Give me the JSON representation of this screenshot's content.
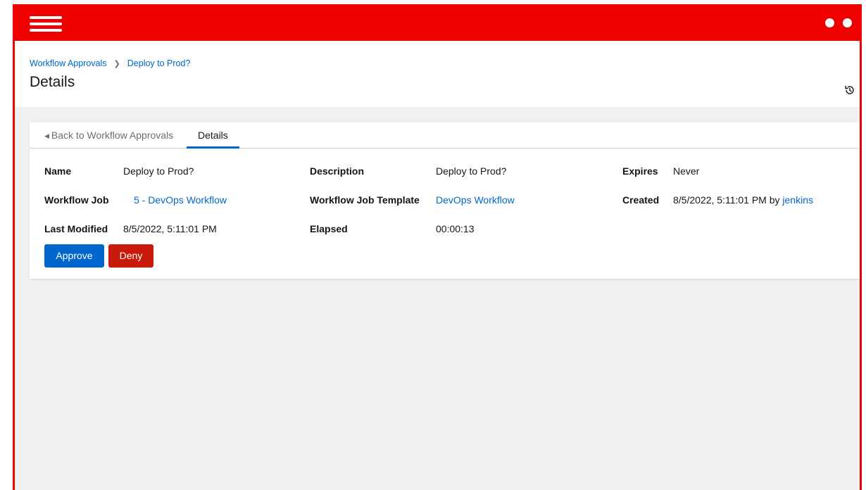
{
  "colors": {
    "brand": "#ee0000",
    "link": "#0066cc",
    "danger": "#c9190b",
    "background": "#f0f0f0"
  },
  "topbar": {
    "menu_icon": "hamburger-icon",
    "window_icon": "dots-icon"
  },
  "breadcrumb": {
    "parent": "Workflow Approvals",
    "current": "Deploy to Prod?"
  },
  "header": {
    "title": "Details",
    "history_icon": "history-icon"
  },
  "tabs": {
    "back_label": "Back to Workflow Approvals",
    "active_label": "Details"
  },
  "details": {
    "name_label": "Name",
    "name_value": "Deploy to Prod?",
    "description_label": "Description",
    "description_value": "Deploy to Prod?",
    "expires_label": "Expires",
    "expires_value": "Never",
    "workflow_job_label": "Workflow Job",
    "workflow_job_value": "5 - DevOps Workflow",
    "workflow_job_template_label": "Workflow Job Template",
    "workflow_job_template_value": "DevOps Workflow",
    "created_label": "Created",
    "created_value": "8/5/2022, 5:11:01 PM by",
    "created_by": "jenkins",
    "last_modified_label": "Last Modified",
    "last_modified_value": "8/5/2022, 5:11:01 PM",
    "elapsed_label": "Elapsed",
    "elapsed_value": "00:00:13"
  },
  "actions": {
    "approve": "Approve",
    "deny": "Deny"
  }
}
